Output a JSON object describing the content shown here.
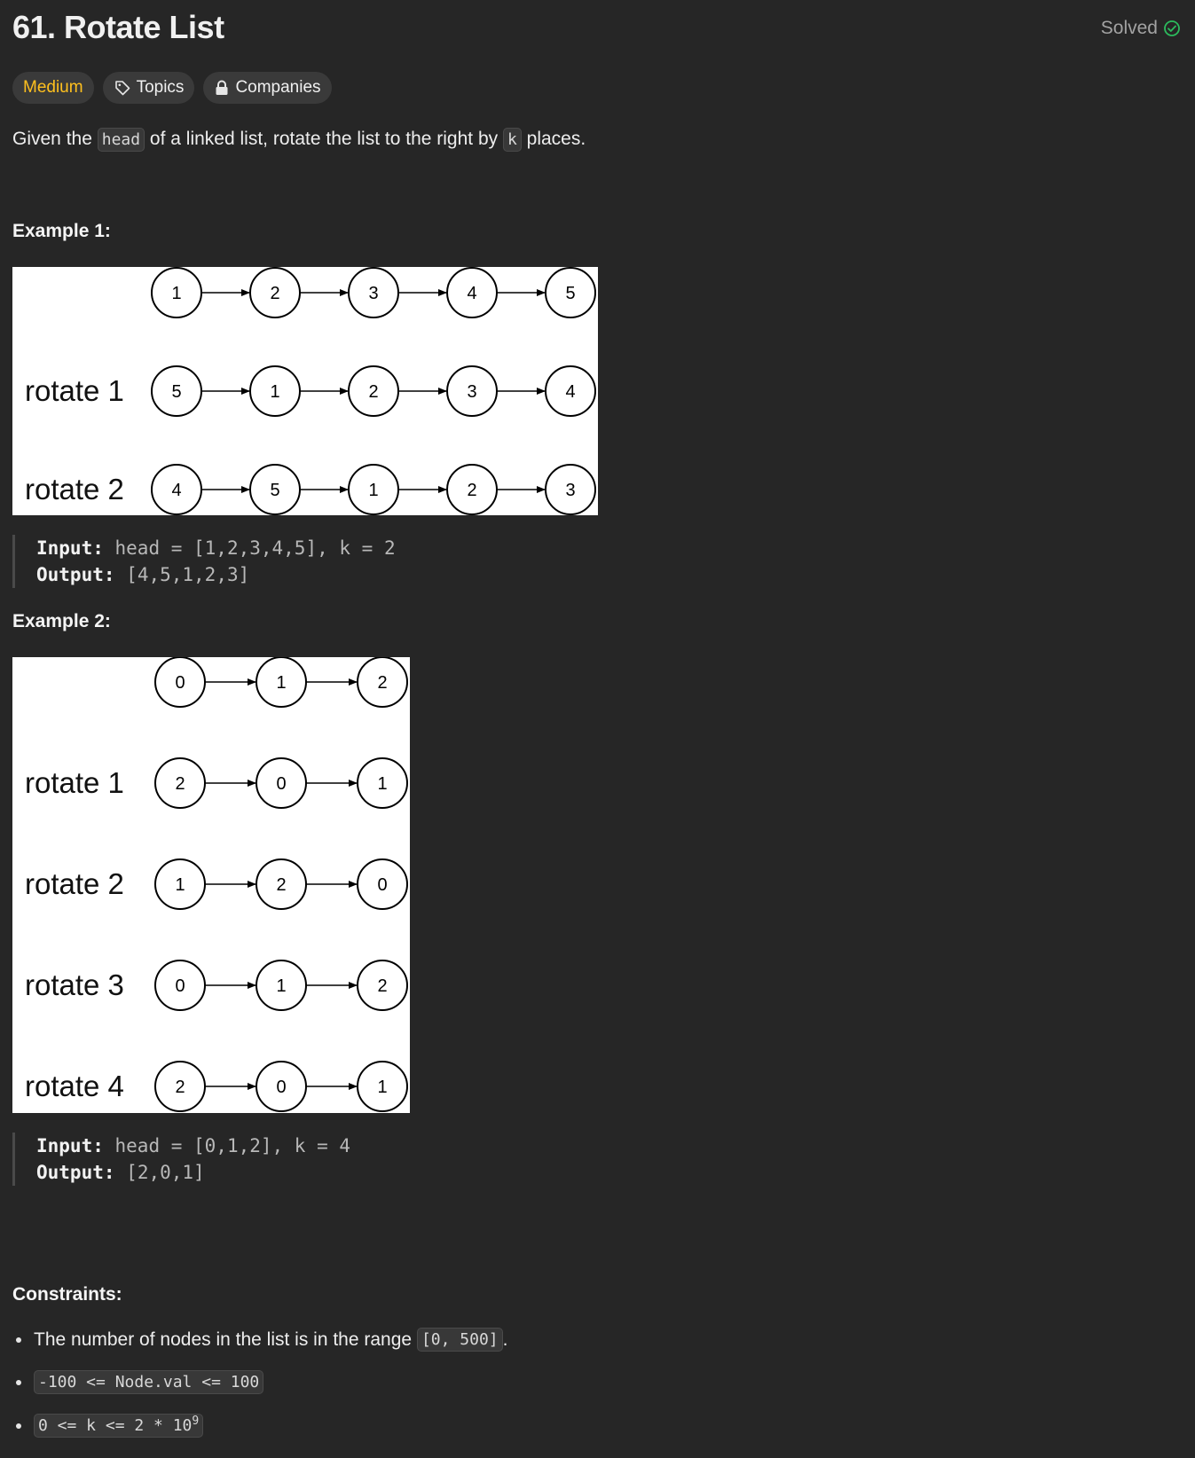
{
  "header": {
    "title": "61. Rotate List",
    "status": "Solved"
  },
  "tags": {
    "difficulty": "Medium",
    "topics": "Topics",
    "companies": "Companies"
  },
  "description": {
    "part1": "Given the ",
    "code_head": "head",
    "part2": " of a linked list, rotate the list to the right by ",
    "code_k": "k",
    "part3": " places."
  },
  "example1": {
    "title": "Example 1:",
    "input_label": "Input:",
    "input_value": "head = [1,2,3,4,5], k = 2",
    "output_label": "Output:",
    "output_value": "[4,5,1,2,3]",
    "diagram": {
      "rows": [
        {
          "label": "",
          "nodes": [
            "1",
            "2",
            "3",
            "4",
            "5"
          ]
        },
        {
          "label": "rotate 1",
          "nodes": [
            "5",
            "1",
            "2",
            "3",
            "4"
          ]
        },
        {
          "label": "rotate 2",
          "nodes": [
            "4",
            "5",
            "1",
            "2",
            "3"
          ]
        }
      ]
    }
  },
  "example2": {
    "title": "Example 2:",
    "input_label": "Input:",
    "input_value": "head = [0,1,2], k = 4",
    "output_label": "Output:",
    "output_value": "[2,0,1]",
    "diagram": {
      "rows": [
        {
          "label": "",
          "nodes": [
            "0",
            "1",
            "2"
          ]
        },
        {
          "label": "rotate 1",
          "nodes": [
            "2",
            "0",
            "1"
          ]
        },
        {
          "label": "rotate 2",
          "nodes": [
            "1",
            "2",
            "0"
          ]
        },
        {
          "label": "rotate 3",
          "nodes": [
            "0",
            "1",
            "2"
          ]
        },
        {
          "label": "rotate 4",
          "nodes": [
            "2",
            "0",
            "1"
          ]
        }
      ]
    }
  },
  "constraints": {
    "title": "Constraints:",
    "item1_text": "The number of nodes in the list is in the range ",
    "item1_code": "[0, 500]",
    "item1_end": ".",
    "item2_code": "-100 <= Node.val <= 100",
    "item3_code_base": "0 <= k <= 2 * 10",
    "item3_code_exp": "9"
  },
  "colors": {
    "background": "#262626",
    "medium": "#ffc01e",
    "solved_check": "#2cbb5d"
  }
}
